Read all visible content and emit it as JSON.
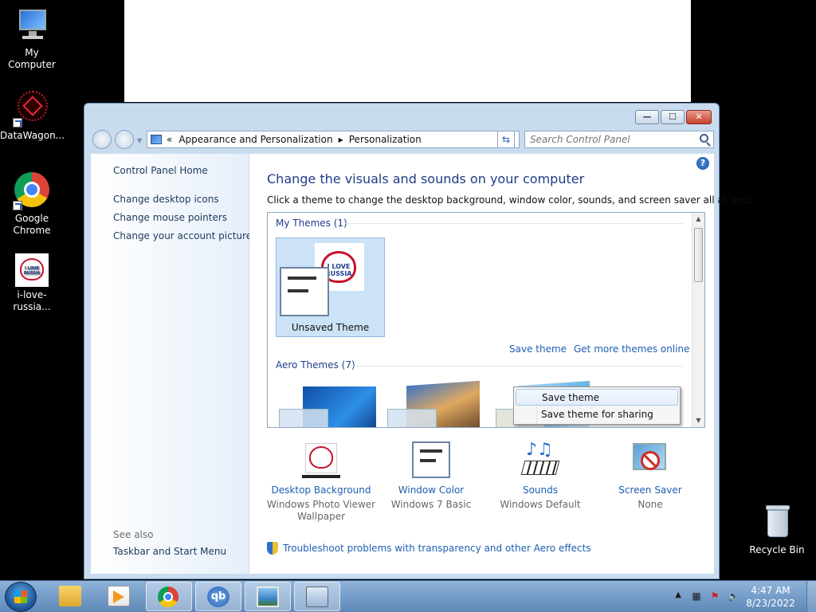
{
  "desktop": {
    "icons": [
      {
        "label": "My Computer"
      },
      {
        "label": "DataWagon..."
      },
      {
        "label": "Google Chrome"
      },
      {
        "label": "i-love-russia..."
      },
      {
        "label": "Recycle Bin"
      }
    ]
  },
  "window": {
    "caption_buttons": {
      "minimize": "—",
      "maximize": "☐",
      "close": "✕"
    },
    "address": {
      "overflow": "«",
      "crumbs": [
        "Appearance and Personalization",
        "Personalization"
      ]
    },
    "search": {
      "placeholder": "Search Control Panel"
    },
    "left_pane": {
      "home": "Control Panel Home",
      "links": [
        "Change desktop icons",
        "Change mouse pointers",
        "Change your account picture"
      ],
      "see_also": "See also",
      "see_also_links": [
        "Taskbar and Start Menu"
      ]
    },
    "main": {
      "help": "?",
      "heading": "Change the visuals and sounds on your computer",
      "subtext": "Click a theme to change the desktop background, window color, sounds, and screen saver all at once.",
      "my_themes_label": "My Themes (1)",
      "unsaved_theme": "Unsaved Theme",
      "theme_logo_text": "I LOVE RUSSIA",
      "save_theme_link": "Save theme",
      "get_more_link": "Get more themes online",
      "aero_label": "Aero Themes (7)",
      "context_menu": [
        "Save theme",
        "Save theme for sharing"
      ],
      "bottom_items": [
        {
          "title": "Desktop Background",
          "sub": "Windows Photo Viewer Wallpaper"
        },
        {
          "title": "Window Color",
          "sub": "Windows 7 Basic"
        },
        {
          "title": "Sounds",
          "sub": "Windows Default"
        },
        {
          "title": "Screen Saver",
          "sub": "None"
        }
      ],
      "troubleshoot": "Troubleshoot problems with transparency and other Aero effects"
    }
  },
  "taskbar": {
    "apps": [
      "windows-explorer",
      "media-player",
      "google-chrome",
      "qbittorrent",
      "photo-viewer",
      "control-panel"
    ],
    "clock": {
      "time": "4:47 AM",
      "date": "8/23/2022"
    }
  },
  "colors": {
    "link": "#1e5fb3",
    "heading": "#1e3c86",
    "window_frame": "#c9dcef"
  }
}
